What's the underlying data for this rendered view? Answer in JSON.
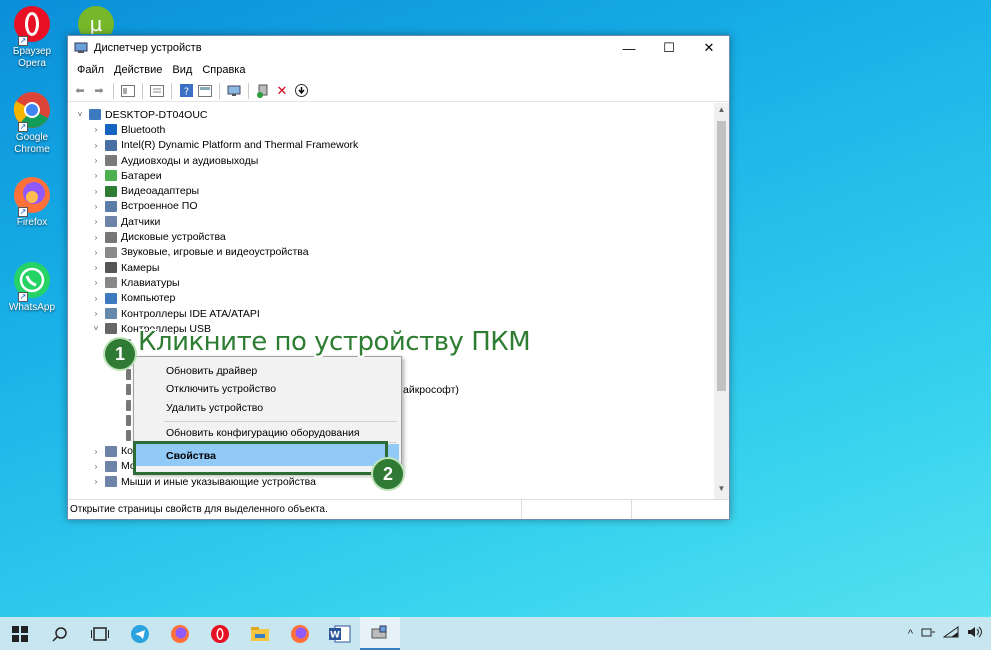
{
  "desktop": {
    "icons": [
      {
        "label": "Браузер Opera",
        "icon": "opera-icon"
      },
      {
        "label": "Google Chrome",
        "icon": "chrome-icon"
      },
      {
        "label": "Firefox",
        "icon": "firefox-icon"
      },
      {
        "label": "WhatsApp",
        "icon": "whatsapp-icon"
      }
    ]
  },
  "window": {
    "title": "Диспетчер устройств",
    "controls": {
      "minimize": "—",
      "maximize": "☐",
      "close": "✕"
    },
    "menu": [
      "Файл",
      "Действие",
      "Вид",
      "Справка"
    ],
    "toolbar": [
      "back-icon",
      "forward-icon",
      "console-tree-icon",
      "properties-icon",
      "help-icon",
      "view-icon",
      "monitor-icon",
      "add-driver-icon",
      "uninstall-icon",
      "update-icon"
    ],
    "tree": {
      "root": "DESKTOP-DT04OUC",
      "items": [
        {
          "label": "Bluetooth",
          "color": "#1565c0",
          "expanded": false
        },
        {
          "label": "Intel(R) Dynamic Platform and Thermal Framework",
          "color": "#4a6fa5",
          "expanded": false
        },
        {
          "label": "Аудиовходы и аудиовыходы",
          "color": "#7a7a7a",
          "expanded": false
        },
        {
          "label": "Батареи",
          "color": "#4caf50",
          "expanded": false
        },
        {
          "label": "Видеоадаптеры",
          "color": "#2e7d32",
          "expanded": false
        },
        {
          "label": "Встроенное ПО",
          "color": "#5b7da8",
          "expanded": false
        },
        {
          "label": "Датчики",
          "color": "#6d84a8",
          "expanded": false
        },
        {
          "label": "Дисковые устройства",
          "color": "#777",
          "expanded": false
        },
        {
          "label": "Звуковые, игровые и видеоустройства",
          "color": "#8a8a8a",
          "expanded": false
        },
        {
          "label": "Камеры",
          "color": "#555",
          "expanded": false
        },
        {
          "label": "Клавиатуры",
          "color": "#888",
          "expanded": false
        },
        {
          "label": "Компьютер",
          "color": "#3d7bbf",
          "expanded": false
        },
        {
          "label": "Контроллеры IDE ATA/ATAPI",
          "color": "#6688aa",
          "expanded": false
        },
        {
          "label": "Контроллеры USB",
          "color": "#666",
          "expanded": true
        }
      ],
      "partial_text": "айкрософт)",
      "bottom_items": [
        "Контроллеры запоминающих устройств",
        "Мониторы",
        "Мыши и иные указывающие устройства"
      ]
    },
    "status": "Открытие страницы свойств для выделенного объекта."
  },
  "context_menu": {
    "items": [
      "Обновить драйвер",
      "Отключить устройство",
      "Удалить устройство",
      "Обновить конфигурацию оборудования",
      "Свойства"
    ]
  },
  "annotations": {
    "callout": "Кликните по устройству ПКМ",
    "badge1": "1",
    "badge2": "2"
  },
  "taskbar": {
    "items": [
      "windows-start-icon",
      "search-icon",
      "task-view-icon",
      "telegram-icon",
      "firefox-icon",
      "opera-icon",
      "file-explorer-icon",
      "firefox-icon",
      "word-icon",
      "device-manager-icon"
    ],
    "tray": [
      "chevron-up-icon",
      "network-device-icon",
      "wifi-icon",
      "volume-icon"
    ]
  }
}
